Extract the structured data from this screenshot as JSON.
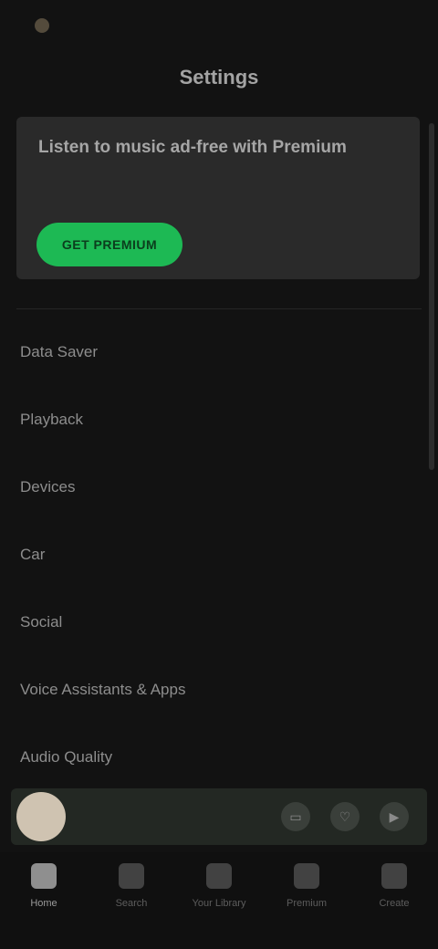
{
  "status_bar": {
    "carrier": "",
    "right_text": ""
  },
  "header": {
    "title": "Settings"
  },
  "premium_card": {
    "headline": "Listen to music ad-free with Premium",
    "subtext": "",
    "cta_label": "GET PREMIUM"
  },
  "settings": [
    {
      "title": "Data Saver",
      "sub": ""
    },
    {
      "title": "Playback",
      "sub": ""
    },
    {
      "title": "Devices",
      "sub": ""
    },
    {
      "title": "Car",
      "sub": ""
    },
    {
      "title": "Social",
      "sub": ""
    },
    {
      "title": "Voice Assistants & Apps",
      "sub": ""
    },
    {
      "title": "Audio Quality",
      "sub": ""
    }
  ],
  "player": {
    "track": "",
    "artist": "",
    "controls": [
      "devices-icon",
      "heart-icon",
      "play-icon"
    ]
  },
  "nav": {
    "items": [
      {
        "label": "Home",
        "icon": "home-icon",
        "active": true
      },
      {
        "label": "Search",
        "icon": "search-icon"
      },
      {
        "label": "Your Library",
        "icon": "library-icon"
      },
      {
        "label": "Premium",
        "icon": "premium-icon"
      },
      {
        "label": "Create",
        "icon": "plus-icon"
      }
    ]
  },
  "colors": {
    "accent": "#1db954",
    "background": "#121212",
    "card": "#2a2a2a"
  }
}
